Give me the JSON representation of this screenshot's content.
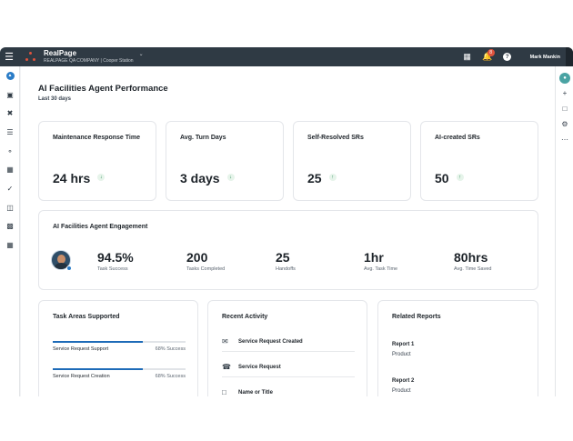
{
  "topbar": {
    "brand_name": "RealPage",
    "company": "REALPAGE QA COMPANY",
    "separator": "|",
    "property": "Cooper Station",
    "notification_count": "8",
    "help_glyph": "?",
    "user_name": "Mark Mankin"
  },
  "page": {
    "title": "AI Facilities Agent Performance",
    "subtitle": "Last 30 days"
  },
  "kpis": [
    {
      "label": "Maintenance Response Time",
      "value": "24 hrs",
      "trend": "down"
    },
    {
      "label": "Avg. Turn Days",
      "value": "3 days",
      "trend": "down"
    },
    {
      "label": "Self-Resolved SRs",
      "value": "25",
      "trend": "up"
    },
    {
      "label": "AI-created SRs",
      "value": "50",
      "trend": "up"
    }
  ],
  "engagement": {
    "title": "AI Facilities Agent Engagement",
    "stats": [
      {
        "value": "94.5%",
        "label": "Task Success"
      },
      {
        "value": "200",
        "label": "Tasks Completed"
      },
      {
        "value": "25",
        "label": "Handoffs"
      },
      {
        "value": "1hr",
        "label": "Avg. Task Time"
      },
      {
        "value": "80hrs",
        "label": "Avg. Time Saved"
      }
    ]
  },
  "task_areas": {
    "title": "Task Areas Supported",
    "items": [
      {
        "name": "Service Request Support",
        "pct_label": "68% Success",
        "progress": 0.68
      },
      {
        "name": "Service Request Creation",
        "pct_label": "68% Success",
        "progress": 0.68
      }
    ]
  },
  "recent_activity": {
    "title": "Recent Activity",
    "items": [
      {
        "icon": "mail-icon",
        "label": "Service Request Created"
      },
      {
        "icon": "phone-icon",
        "label": "Service Request"
      },
      {
        "icon": "document-icon",
        "label": "Name or Title"
      }
    ]
  },
  "related_reports": {
    "title": "Related Reports",
    "items": [
      {
        "title": "Report 1",
        "sub": "Product"
      },
      {
        "title": "Report 2",
        "sub": "Product"
      }
    ]
  },
  "icons": {
    "left_nav": [
      "ai-assistant-icon",
      "calendar-icon",
      "tools-icon",
      "list-icon",
      "key-icon",
      "boxes-icon",
      "check-icon",
      "package-icon",
      "building-chart-icon",
      "building-icon"
    ],
    "right_nav": [
      "ai-agent-icon",
      "plus-icon",
      "chat-icon",
      "gear-icon",
      "more-icon"
    ]
  },
  "colors": {
    "topbar": "#2f3a44",
    "accent": "#1e6bb8",
    "brand_red": "#e0533d",
    "trend_green": "#2e8b57"
  }
}
